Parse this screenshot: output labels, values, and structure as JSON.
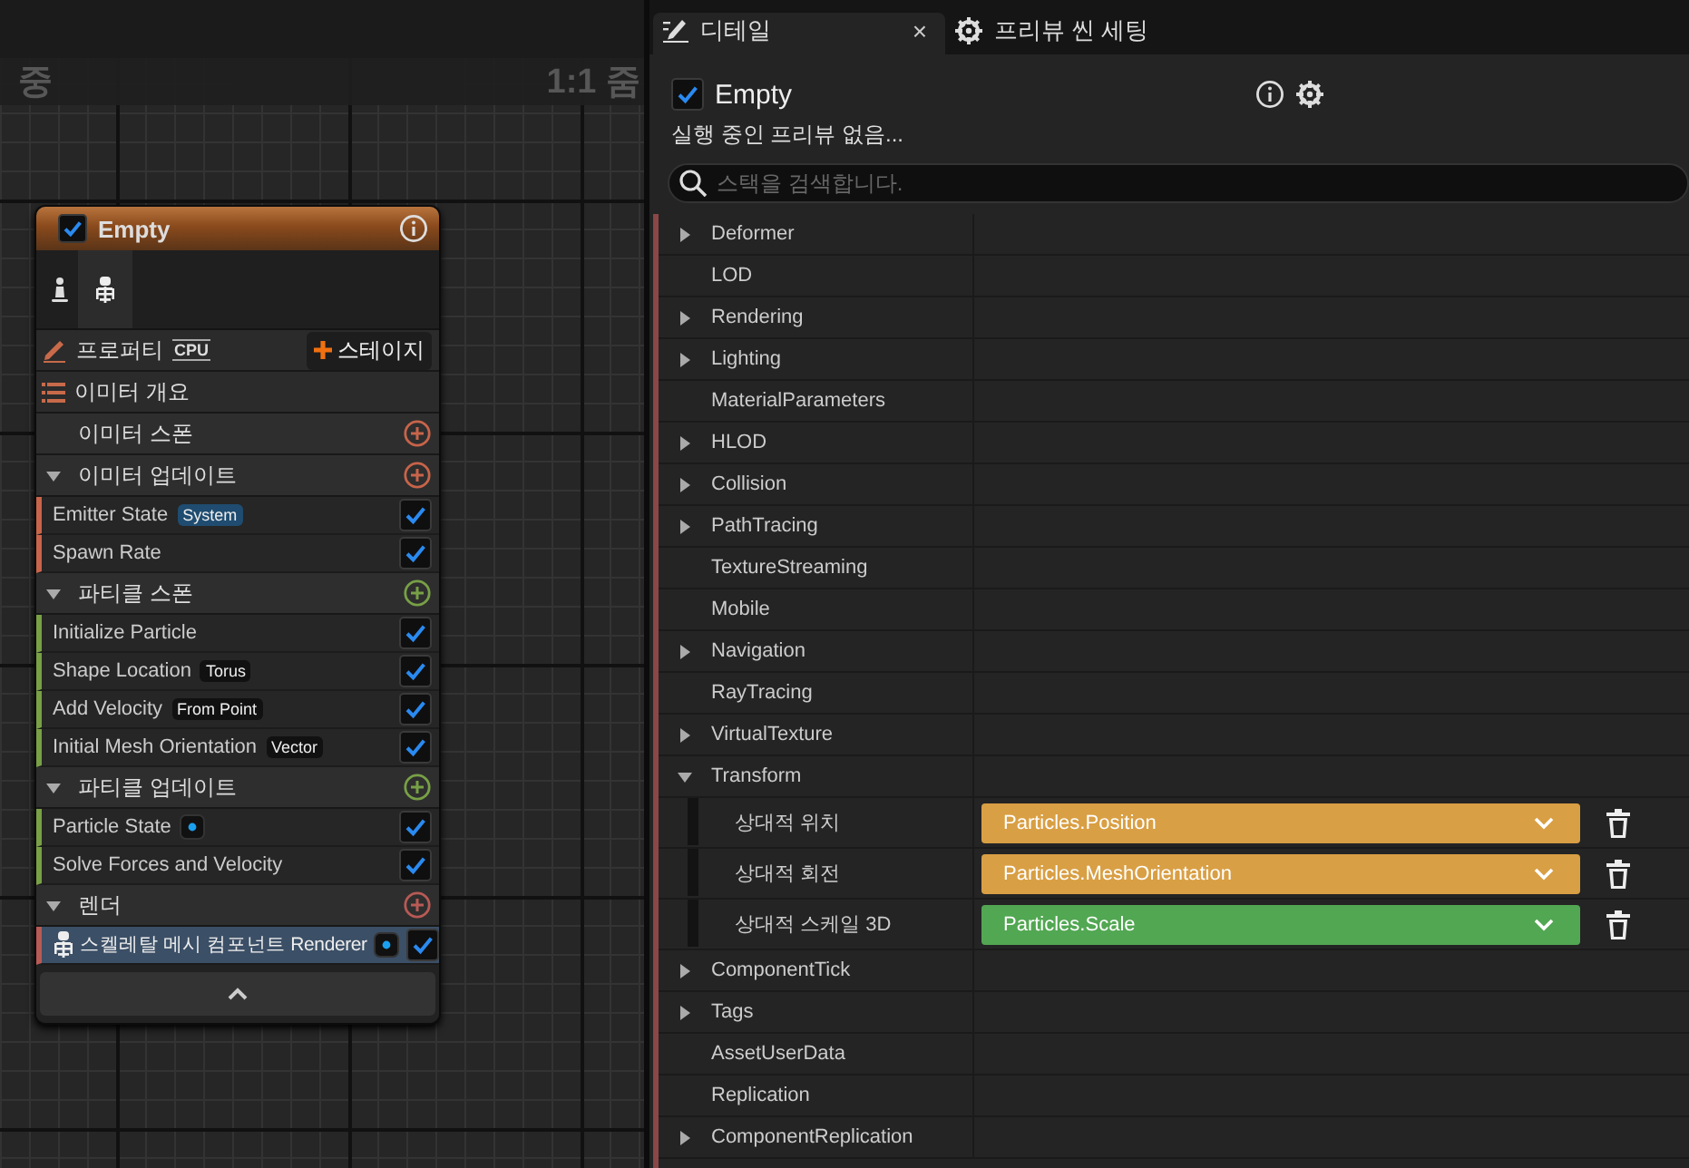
{
  "canvas": {
    "title_left": "중",
    "zoom_label": "1:1 줌"
  },
  "node": {
    "title": "Empty",
    "enabled": true,
    "properties": {
      "label": "프로퍼티",
      "badge": "CPU",
      "stage_button": "스테이지"
    },
    "summary": "이미터 개요",
    "sections": [
      {
        "title": "이미터 스폰",
        "color": "#c8644a",
        "expandable": false,
        "expanded": false
      },
      {
        "title": "이미터 업데이트",
        "color": "#c8644a",
        "expandable": true,
        "expanded": true,
        "modules": [
          {
            "kind": "module",
            "label": "Emitter State",
            "tag": {
              "text": "System",
              "color": "#1f4c70"
            },
            "dot": false,
            "enabled": true,
            "marker": false,
            "selected": false
          },
          {
            "kind": "module",
            "label": "Spawn Rate",
            "dot": false,
            "enabled": true,
            "marker": false,
            "selected": false
          }
        ]
      },
      {
        "title": "파티클 스폰",
        "color": "#78a046",
        "expandable": true,
        "expanded": true,
        "modules": [
          {
            "kind": "module",
            "label": "Initialize Particle",
            "dot": false,
            "enabled": true,
            "marker": false,
            "selected": false
          },
          {
            "kind": "module",
            "label": "Shape Location",
            "tag": {
              "text": "Torus",
              "color": "#111111"
            },
            "dot": false,
            "enabled": true,
            "marker": false,
            "selected": false
          },
          {
            "kind": "module",
            "label": "Add Velocity",
            "tag": {
              "text": "From Point",
              "color": "#111111"
            },
            "dot": false,
            "enabled": true,
            "marker": false,
            "selected": false
          },
          {
            "kind": "module",
            "label": "Initial Mesh Orientation",
            "tag": {
              "text": "Vector",
              "color": "#111111"
            },
            "dot": false,
            "enabled": true,
            "marker": false,
            "selected": false
          }
        ]
      },
      {
        "title": "파티클 업데이트",
        "color": "#78a046",
        "expandable": true,
        "expanded": true,
        "modules": [
          {
            "kind": "module",
            "label": "Particle State",
            "dot": true,
            "enabled": true,
            "marker": true,
            "selected": false
          },
          {
            "kind": "module",
            "label": "Solve Forces and Velocity",
            "dot": false,
            "enabled": true,
            "marker": false,
            "selected": false
          }
        ]
      },
      {
        "title": "렌더",
        "color": "#b85a55",
        "expandable": true,
        "expanded": true,
        "modules": [
          {
            "kind": "renderer",
            "label": "스켈레탈 메시 컴포넌트 Renderer",
            "dot": true,
            "enabled": true,
            "marker": true,
            "selected": true
          }
        ]
      }
    ]
  },
  "details": {
    "tabs": [
      {
        "kind": "details",
        "label": "디테일",
        "selected": true,
        "closable": true,
        "close": "×"
      },
      {
        "kind": "settings",
        "label": "프리뷰 씬 세팅",
        "selected": false,
        "closable": false
      }
    ],
    "object": {
      "name": "Empty",
      "enabled": true
    },
    "status": "실행 중인 프리뷰 없음...",
    "search": {
      "placeholder": "스택을 검색합니다."
    },
    "categories": [
      {
        "label": "Deformer",
        "expandable": true,
        "expanded": false
      },
      {
        "label": "LOD",
        "expandable": false,
        "expanded": false
      },
      {
        "label": "Rendering",
        "expandable": true,
        "expanded": false
      },
      {
        "label": "Lighting",
        "expandable": true,
        "expanded": false
      },
      {
        "label": "MaterialParameters",
        "expandable": false,
        "expanded": false
      },
      {
        "label": "HLOD",
        "expandable": true,
        "expanded": false
      },
      {
        "label": "Collision",
        "expandable": true,
        "expanded": false
      },
      {
        "label": "PathTracing",
        "expandable": true,
        "expanded": false
      },
      {
        "label": "TextureStreaming",
        "expandable": false,
        "expanded": false
      },
      {
        "label": "Mobile",
        "expandable": false,
        "expanded": false
      },
      {
        "label": "Navigation",
        "expandable": true,
        "expanded": false
      },
      {
        "label": "RayTracing",
        "expandable": false,
        "expanded": false
      },
      {
        "label": "VirtualTexture",
        "expandable": true,
        "expanded": false
      },
      {
        "label": "Transform",
        "expandable": true,
        "expanded": true,
        "children": [
          {
            "label": "상대적 위치",
            "value": "Particles.Position",
            "color": "#d99f44"
          },
          {
            "label": "상대적 회전",
            "value": "Particles.MeshOrientation",
            "color": "#d99f44"
          },
          {
            "label": "상대적 스케일 3D",
            "value": "Particles.Scale",
            "color": "#52a752"
          }
        ]
      },
      {
        "label": "ComponentTick",
        "expandable": true,
        "expanded": false
      },
      {
        "label": "Tags",
        "expandable": true,
        "expanded": false
      },
      {
        "label": "AssetUserData",
        "expandable": false,
        "expanded": false
      },
      {
        "label": "Replication",
        "expandable": false,
        "expanded": false
      },
      {
        "label": "ComponentReplication",
        "expandable": true,
        "expanded": false
      }
    ]
  }
}
